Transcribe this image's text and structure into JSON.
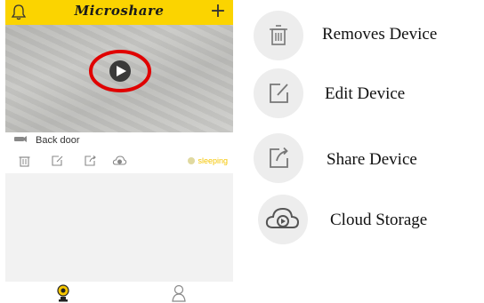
{
  "app": {
    "title": "Microshare"
  },
  "device": {
    "name": "Back door",
    "status": "sleeping"
  },
  "legend": [
    {
      "icon": "trash-icon",
      "label": "Removes Device"
    },
    {
      "icon": "edit-icon",
      "label": "Edit Device"
    },
    {
      "icon": "share-icon",
      "label": "Share Device"
    },
    {
      "icon": "cloud-play-icon",
      "label": "Cloud Storage"
    }
  ],
  "colors": {
    "brand_yellow": "#fbd400",
    "highlight_red": "#e00000",
    "status_yellow": "#f5c500"
  }
}
